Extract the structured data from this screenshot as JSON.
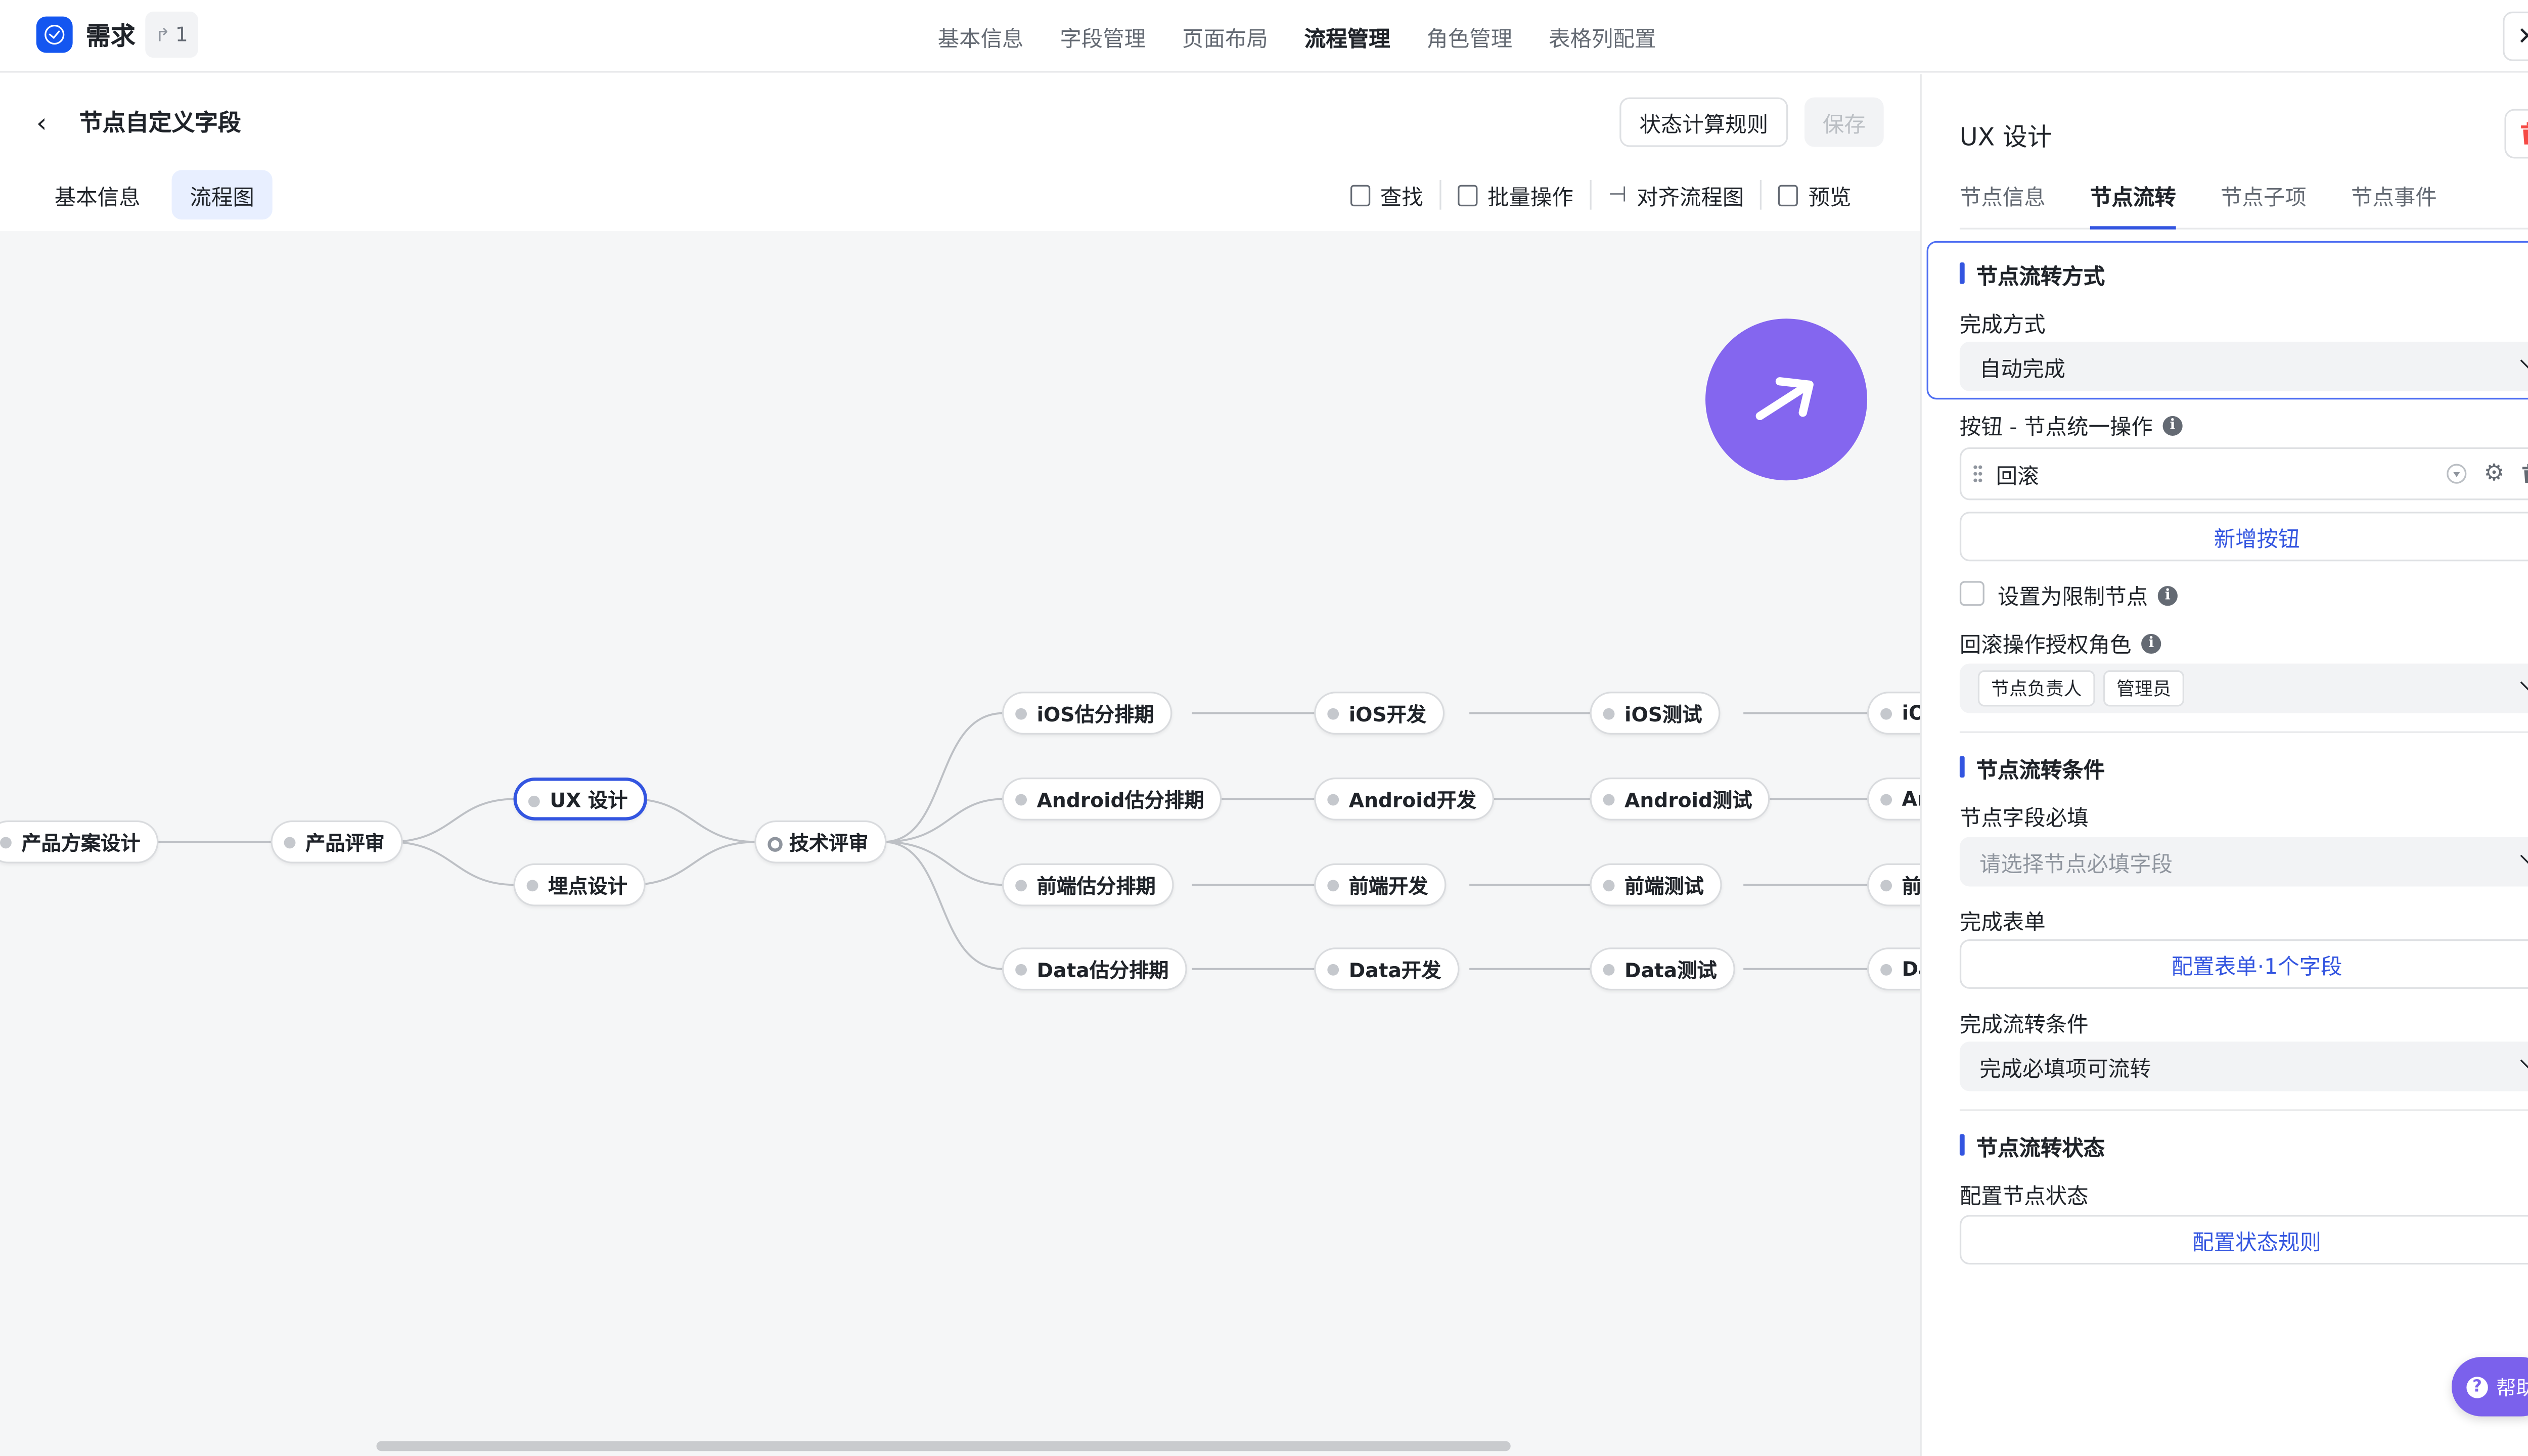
{
  "app": {
    "title": "需求",
    "share_count": "1"
  },
  "top_nav": {
    "tabs": [
      "基本信息",
      "字段管理",
      "页面布局",
      "流程管理",
      "角色管理",
      "表格列配置"
    ],
    "active": "流程管理"
  },
  "page": {
    "title": "节点自定义字段",
    "rule_button": "状态计算规则",
    "save_button": "保存",
    "sub_tabs": [
      "基本信息",
      "流程图"
    ],
    "active_sub_tab": "流程图",
    "toolbar": [
      "查找",
      "批量操作",
      "对齐流程图",
      "预览"
    ]
  },
  "flow": {
    "nodes": {
      "n1": "产品方案设计",
      "n2": "产品评审",
      "n3": "UX 设计",
      "n4": "埋点设计",
      "n5": "技术评审",
      "ios1": "iOS估分排期",
      "ios2": "iOS开发",
      "ios3": "iOS测试",
      "ios4": "iOS",
      "and1": "Android估分排期",
      "and2": "Android开发",
      "and3": "Android测试",
      "and4": "An",
      "fe1": "前端估分排期",
      "fe2": "前端开发",
      "fe3": "前端测试",
      "fe4": "前端",
      "d1": "Data估分排期",
      "d2": "Data开发",
      "d3": "Data测试",
      "d4": "Da"
    },
    "selected": "UX 设计",
    "fab_icon": "arrow-up-right-icon"
  },
  "panel": {
    "title": "UX 设计",
    "tabs": [
      "节点信息",
      "节点流转",
      "节点子项",
      "节点事件"
    ],
    "active_tab": "节点流转",
    "section1_title": "节点流转方式",
    "complete_mode_label": "完成方式",
    "complete_mode_value": "自动完成",
    "buttons_label": "按钮 - 节点统一操作",
    "button_item": "回滚",
    "add_button": "新增按钮",
    "restrict_label": "设置为限制节点",
    "rollback_roles_label": "回滚操作授权角色",
    "rollback_roles": [
      "节点负责人",
      "管理员"
    ],
    "section2_title": "节点流转条件",
    "required_fields_label": "节点字段必填",
    "required_fields_placeholder": "请选择节点必填字段",
    "complete_form_label": "完成表单",
    "complete_form_button": "配置表单·1个字段",
    "complete_condition_label": "完成流转条件",
    "complete_condition_value": "完成必填项可流转",
    "section3_title": "节点流转状态",
    "node_status_label": "配置节点状态",
    "node_status_button": "配置状态规则"
  },
  "help": "帮助",
  "colors": {
    "accent": "#3355e0",
    "fab": "#8466ef",
    "danger": "#f54a45"
  }
}
